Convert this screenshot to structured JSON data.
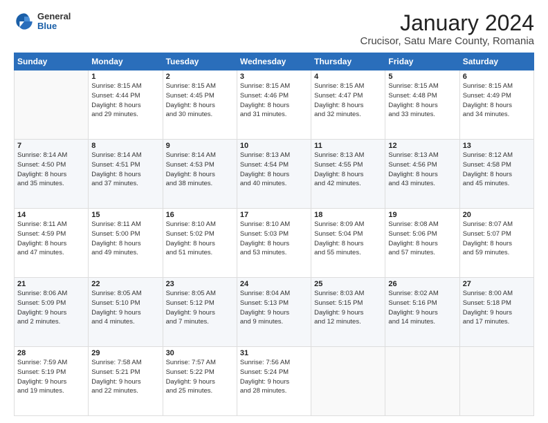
{
  "header": {
    "logo_general": "General",
    "logo_blue": "Blue",
    "main_title": "January 2024",
    "subtitle": "Crucisor, Satu Mare County, Romania"
  },
  "weekdays": [
    "Sunday",
    "Monday",
    "Tuesday",
    "Wednesday",
    "Thursday",
    "Friday",
    "Saturday"
  ],
  "weeks": [
    [
      {
        "day": "",
        "info": ""
      },
      {
        "day": "1",
        "info": "Sunrise: 8:15 AM\nSunset: 4:44 PM\nDaylight: 8 hours\nand 29 minutes."
      },
      {
        "day": "2",
        "info": "Sunrise: 8:15 AM\nSunset: 4:45 PM\nDaylight: 8 hours\nand 30 minutes."
      },
      {
        "day": "3",
        "info": "Sunrise: 8:15 AM\nSunset: 4:46 PM\nDaylight: 8 hours\nand 31 minutes."
      },
      {
        "day": "4",
        "info": "Sunrise: 8:15 AM\nSunset: 4:47 PM\nDaylight: 8 hours\nand 32 minutes."
      },
      {
        "day": "5",
        "info": "Sunrise: 8:15 AM\nSunset: 4:48 PM\nDaylight: 8 hours\nand 33 minutes."
      },
      {
        "day": "6",
        "info": "Sunrise: 8:15 AM\nSunset: 4:49 PM\nDaylight: 8 hours\nand 34 minutes."
      }
    ],
    [
      {
        "day": "7",
        "info": "Sunrise: 8:14 AM\nSunset: 4:50 PM\nDaylight: 8 hours\nand 35 minutes."
      },
      {
        "day": "8",
        "info": "Sunrise: 8:14 AM\nSunset: 4:51 PM\nDaylight: 8 hours\nand 37 minutes."
      },
      {
        "day": "9",
        "info": "Sunrise: 8:14 AM\nSunset: 4:53 PM\nDaylight: 8 hours\nand 38 minutes."
      },
      {
        "day": "10",
        "info": "Sunrise: 8:13 AM\nSunset: 4:54 PM\nDaylight: 8 hours\nand 40 minutes."
      },
      {
        "day": "11",
        "info": "Sunrise: 8:13 AM\nSunset: 4:55 PM\nDaylight: 8 hours\nand 42 minutes."
      },
      {
        "day": "12",
        "info": "Sunrise: 8:13 AM\nSunset: 4:56 PM\nDaylight: 8 hours\nand 43 minutes."
      },
      {
        "day": "13",
        "info": "Sunrise: 8:12 AM\nSunset: 4:58 PM\nDaylight: 8 hours\nand 45 minutes."
      }
    ],
    [
      {
        "day": "14",
        "info": "Sunrise: 8:11 AM\nSunset: 4:59 PM\nDaylight: 8 hours\nand 47 minutes."
      },
      {
        "day": "15",
        "info": "Sunrise: 8:11 AM\nSunset: 5:00 PM\nDaylight: 8 hours\nand 49 minutes."
      },
      {
        "day": "16",
        "info": "Sunrise: 8:10 AM\nSunset: 5:02 PM\nDaylight: 8 hours\nand 51 minutes."
      },
      {
        "day": "17",
        "info": "Sunrise: 8:10 AM\nSunset: 5:03 PM\nDaylight: 8 hours\nand 53 minutes."
      },
      {
        "day": "18",
        "info": "Sunrise: 8:09 AM\nSunset: 5:04 PM\nDaylight: 8 hours\nand 55 minutes."
      },
      {
        "day": "19",
        "info": "Sunrise: 8:08 AM\nSunset: 5:06 PM\nDaylight: 8 hours\nand 57 minutes."
      },
      {
        "day": "20",
        "info": "Sunrise: 8:07 AM\nSunset: 5:07 PM\nDaylight: 8 hours\nand 59 minutes."
      }
    ],
    [
      {
        "day": "21",
        "info": "Sunrise: 8:06 AM\nSunset: 5:09 PM\nDaylight: 9 hours\nand 2 minutes."
      },
      {
        "day": "22",
        "info": "Sunrise: 8:05 AM\nSunset: 5:10 PM\nDaylight: 9 hours\nand 4 minutes."
      },
      {
        "day": "23",
        "info": "Sunrise: 8:05 AM\nSunset: 5:12 PM\nDaylight: 9 hours\nand 7 minutes."
      },
      {
        "day": "24",
        "info": "Sunrise: 8:04 AM\nSunset: 5:13 PM\nDaylight: 9 hours\nand 9 minutes."
      },
      {
        "day": "25",
        "info": "Sunrise: 8:03 AM\nSunset: 5:15 PM\nDaylight: 9 hours\nand 12 minutes."
      },
      {
        "day": "26",
        "info": "Sunrise: 8:02 AM\nSunset: 5:16 PM\nDaylight: 9 hours\nand 14 minutes."
      },
      {
        "day": "27",
        "info": "Sunrise: 8:00 AM\nSunset: 5:18 PM\nDaylight: 9 hours\nand 17 minutes."
      }
    ],
    [
      {
        "day": "28",
        "info": "Sunrise: 7:59 AM\nSunset: 5:19 PM\nDaylight: 9 hours\nand 19 minutes."
      },
      {
        "day": "29",
        "info": "Sunrise: 7:58 AM\nSunset: 5:21 PM\nDaylight: 9 hours\nand 22 minutes."
      },
      {
        "day": "30",
        "info": "Sunrise: 7:57 AM\nSunset: 5:22 PM\nDaylight: 9 hours\nand 25 minutes."
      },
      {
        "day": "31",
        "info": "Sunrise: 7:56 AM\nSunset: 5:24 PM\nDaylight: 9 hours\nand 28 minutes."
      },
      {
        "day": "",
        "info": ""
      },
      {
        "day": "",
        "info": ""
      },
      {
        "day": "",
        "info": ""
      }
    ]
  ]
}
